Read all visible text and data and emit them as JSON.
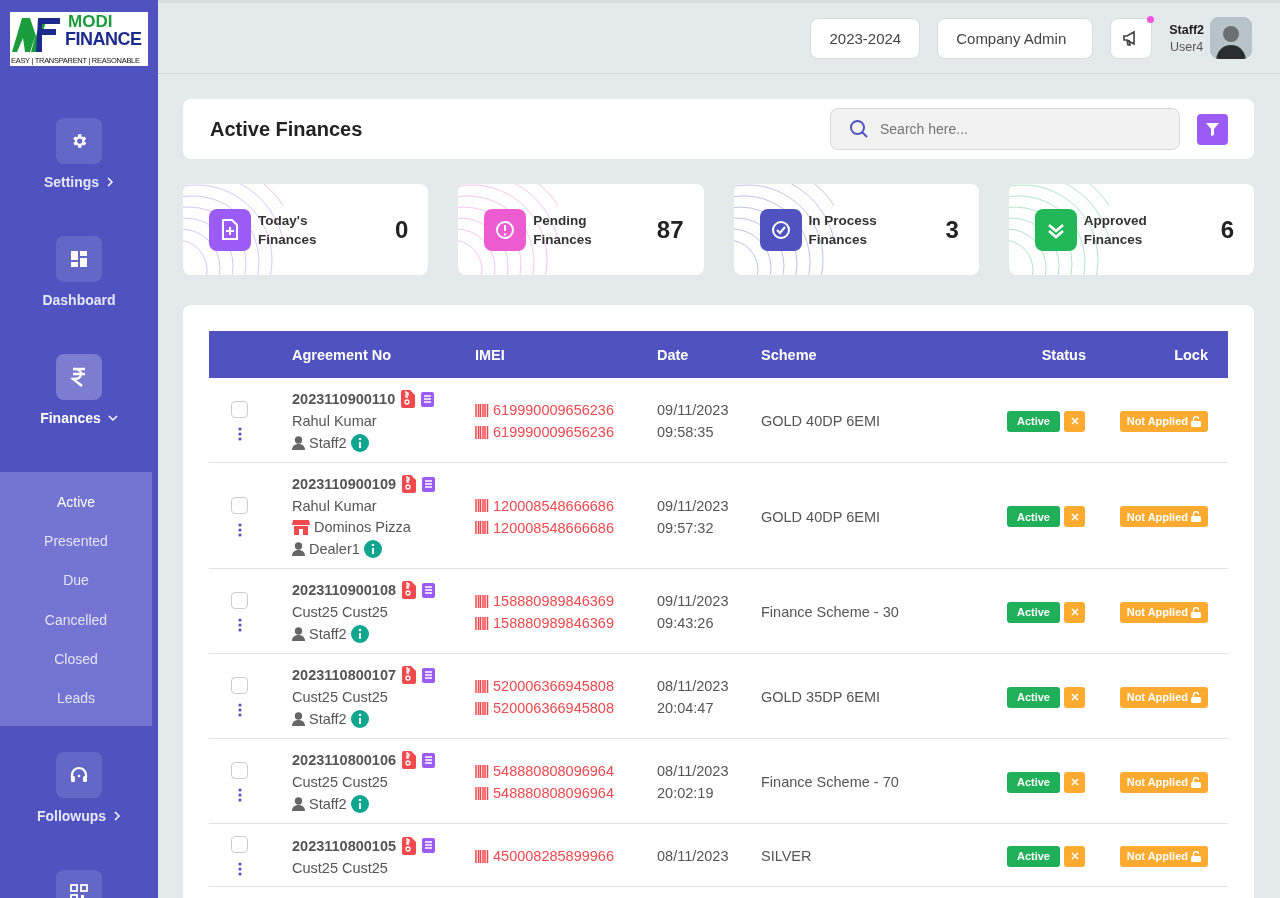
{
  "logo": {
    "line1": "MODI",
    "line2": "FINANCE",
    "tagline": "EASY | TRANSPARENT | REASONABLE"
  },
  "sidebar": {
    "items": [
      {
        "label": "Settings",
        "kind": "gear",
        "selected": false,
        "expandable": true,
        "expanded": false
      },
      {
        "label": "Dashboard",
        "kind": "grid",
        "selected": false,
        "expandable": false
      },
      {
        "label": "Finances",
        "kind": "rupee",
        "selected": true,
        "expandable": true,
        "expanded": true,
        "children": [
          {
            "label": "Active",
            "selected": true
          },
          {
            "label": "Presented",
            "selected": false
          },
          {
            "label": "Due",
            "selected": false
          },
          {
            "label": "Cancelled",
            "selected": false
          },
          {
            "label": "Closed",
            "selected": false
          },
          {
            "label": "Leads",
            "selected": false
          }
        ]
      },
      {
        "label": "Followups",
        "kind": "headset",
        "selected": false,
        "expandable": true,
        "expanded": false
      },
      {
        "kind": "qr",
        "selected": false
      }
    ]
  },
  "topbar": {
    "year": "2023-2024",
    "role": "Company Admin",
    "has_notification": true,
    "user_name": "Staff2",
    "user_sub": "User4"
  },
  "page": {
    "title": "Active Finances",
    "search": {
      "placeholder": "Search here..."
    }
  },
  "stats": [
    {
      "label": "Today's Finances",
      "value": "0",
      "kind": "file-plus",
      "color": "#9b5cf6"
    },
    {
      "label": "Pending Finances",
      "value": "87",
      "kind": "alert",
      "color": "#ec5cd0"
    },
    {
      "label": "In Process Finances",
      "value": "3",
      "kind": "check-circle",
      "color": "#5052c0"
    },
    {
      "label": "Approved Finances",
      "value": "6",
      "kind": "double-check",
      "color": "#22b85a"
    }
  ],
  "table": {
    "columns": [
      "Agreement No",
      "IMEI",
      "Date",
      "Scheme",
      "Status",
      "Lock"
    ],
    "rows": [
      {
        "checked": false,
        "agreement": "2023110900110",
        "customer": "Rahul Kumar",
        "user": "Staff2",
        "imei": [
          "619990009656236",
          "619990009656236"
        ],
        "date": "09/11/2023",
        "time": "09:58:35",
        "scheme": "GOLD 40DP 6EMI",
        "status": "Active",
        "lock": "Not Applied"
      },
      {
        "checked": false,
        "agreement": "2023110900109",
        "customer": "Rahul Kumar",
        "store": "Dominos Pizza",
        "user": "Dealer1",
        "imei": [
          "120008548666686",
          "120008548666686"
        ],
        "date": "09/11/2023",
        "time": "09:57:32",
        "scheme": "GOLD 40DP 6EMI",
        "status": "Active",
        "lock": "Not Applied"
      },
      {
        "checked": false,
        "agreement": "2023110900108",
        "customer": "Cust25 Cust25",
        "user": "Staff2",
        "imei": [
          "158880989846369",
          "158880989846369"
        ],
        "date": "09/11/2023",
        "time": "09:43:26",
        "scheme": "Finance Scheme - 30",
        "status": "Active",
        "lock": "Not Applied"
      },
      {
        "checked": false,
        "agreement": "2023110800107",
        "customer": "Cust25 Cust25",
        "user": "Staff2",
        "imei": [
          "520006366945808",
          "520006366945808"
        ],
        "date": "08/11/2023",
        "time": "20:04:47",
        "scheme": "GOLD 35DP 6EMI",
        "status": "Active",
        "lock": "Not Applied"
      },
      {
        "checked": false,
        "agreement": "2023110800106",
        "customer": "Cust25 Cust25",
        "user": "Staff2",
        "imei": [
          "548880808096964",
          "548880808096964"
        ],
        "date": "08/11/2023",
        "time": "20:02:19",
        "scheme": "Finance Scheme - 70",
        "status": "Active",
        "lock": "Not Applied"
      },
      {
        "checked": false,
        "agreement": "2023110800105",
        "customer": "Cust25 Cust25",
        "imei": [
          "450008285899966"
        ],
        "date": "08/11/2023",
        "scheme": "SILVER",
        "status": "Active",
        "lock": "Not Applied"
      }
    ]
  }
}
